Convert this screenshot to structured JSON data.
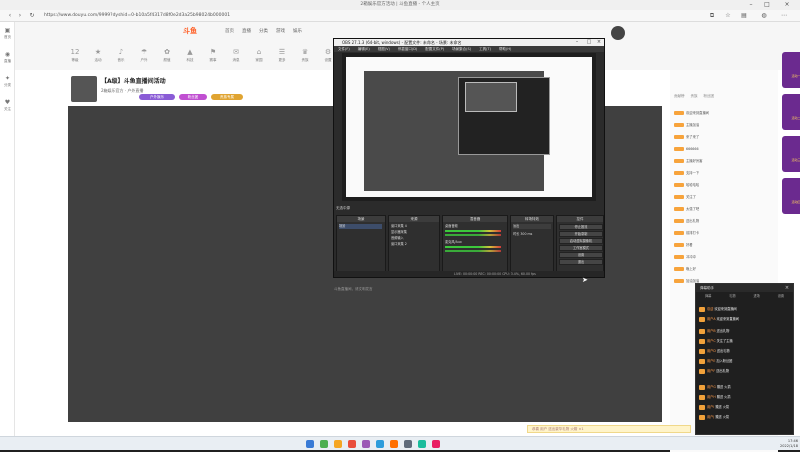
{
  "window": {
    "title": "2箱娱乐官方活动 | 斗鱼直播 - 个人主页"
  },
  "browser": {
    "url": "https://www.douyu.com/9999?dyshid=0-b10a5f4317d8f0e2d3a25b98024b000001"
  },
  "leftbar": {
    "items": [
      {
        "icon": "▣",
        "label": "首页"
      },
      {
        "icon": "◉",
        "label": "直播"
      },
      {
        "icon": "✦",
        "label": "分类"
      },
      {
        "icon": "♥",
        "label": "关注"
      }
    ]
  },
  "site": {
    "logo": "斗鱼",
    "topnav": [
      "首页",
      "直播",
      "分类",
      "游戏",
      "娱乐"
    ],
    "subnav": [
      {
        "icon": "12",
        "label": "等级"
      },
      {
        "icon": "★",
        "label": "活动"
      },
      {
        "icon": "♪",
        "label": "音乐"
      },
      {
        "icon": "☂",
        "label": "户外"
      },
      {
        "icon": "✿",
        "label": "颜值"
      },
      {
        "icon": "▲",
        "label": "科技"
      },
      {
        "icon": "⚑",
        "label": "赛事"
      },
      {
        "icon": "✉",
        "label": "消息"
      },
      {
        "icon": "⌂",
        "label": "家园"
      },
      {
        "icon": "☰",
        "label": "更多"
      },
      {
        "icon": "♛",
        "label": "贵族"
      },
      {
        "icon": "⚙",
        "label": "设置"
      }
    ]
  },
  "room": {
    "title": "【A级】斗鱼直播间活动",
    "meta": "2箱娱乐官方 · 户外直播",
    "tags": [
      "户外娱乐",
      "粉丝团",
      "贵族专属"
    ]
  },
  "obs": {
    "title": "OBS 27.1.3 (64-bit, windows) - 配置文件: 未命名 - 场景: 未命名",
    "menu": [
      "文件(F)",
      "编辑(E)",
      "视图(V)",
      "停靠窗口(D)",
      "配置文件(P)",
      "场景集合(S)",
      "工具(T)",
      "帮助(H)"
    ],
    "sub_label": "无选中源",
    "docks": {
      "scenes": {
        "title": "场景",
        "items": [
          "场景"
        ]
      },
      "sources": {
        "title": "来源",
        "items": [
          "窗口采集 4",
          "显示器采集",
          "音频输入",
          "窗口采集 2"
        ]
      },
      "mixer": {
        "title": "混音器",
        "items": [
          "桌面音频",
          "麦克风/Aux"
        ]
      },
      "transitions": {
        "title": "转场特效",
        "items": [
          "淡出",
          "时长 300 ms"
        ]
      },
      "controls": {
        "title": "控件",
        "items": [
          "停止推流",
          "开始录制",
          "启动虚拟摄像机",
          "工作室模式",
          "设置",
          "退出"
        ]
      }
    },
    "status": "LIVE: 00:00:00   REC: 00:00:00   CPU: 3.4%, 60.00 fps"
  },
  "caption": "斗鱼直播间，请文明发言",
  "sidepanel": {
    "tabs": [
      "贡献榜",
      "贵族",
      "粉丝团"
    ],
    "chat": [
      "欢迎来到直播间",
      "主播加油",
      "来了来了",
      "666666",
      "主播好厉害",
      "支持一下",
      "哈哈哈哈",
      "关注了",
      "太强了吧",
      "送出礼物",
      "前排打卡",
      "好看",
      "冲冲冲",
      "晚上好",
      "加油加油"
    ]
  },
  "promo": [
    "活动一",
    "活动二",
    "活动三",
    "活动四"
  ],
  "overlay": {
    "title": "弹幕助手",
    "tabs": [
      "弹幕",
      "礼物",
      "进场",
      "设置"
    ],
    "lines": [
      {
        "name": "欢迎",
        "text": "欢迎来到直播间"
      },
      {
        "name": "用户A",
        "text": "欢迎来到直播间"
      },
      {
        "name": "用户B",
        "text": "送出礼物"
      },
      {
        "name": "用户C",
        "text": "关注了主播"
      },
      {
        "name": "用户D",
        "text": "送出礼物"
      },
      {
        "name": "用户E",
        "text": "加入粉丝团"
      },
      {
        "name": "用户F",
        "text": "送出礼物"
      },
      {
        "name": "用户G",
        "text": "赠送 火箭"
      },
      {
        "name": "用户H",
        "text": "赠送 火箭"
      },
      {
        "name": "用户I",
        "text": "赠送 火箭"
      },
      {
        "name": "用户J",
        "text": "赠送 火箭"
      }
    ]
  },
  "giftbar": "恭喜 用户 送出豪华礼物 火箭 ×1",
  "taskbar": {
    "icons": [
      "#3a7bd5",
      "#4caf50",
      "#f5a623",
      "#e94e3c",
      "#9b59b6",
      "#2d9cdb",
      "#ff6f00",
      "#5f6b7a",
      "#1abc9c",
      "#e91e63"
    ],
    "time": "17:46",
    "date": "2022/1/18"
  },
  "colors": {
    "accent": "#ff5d23",
    "obs_bg": "#2b2b2b",
    "promo": "#6b2a8f"
  }
}
